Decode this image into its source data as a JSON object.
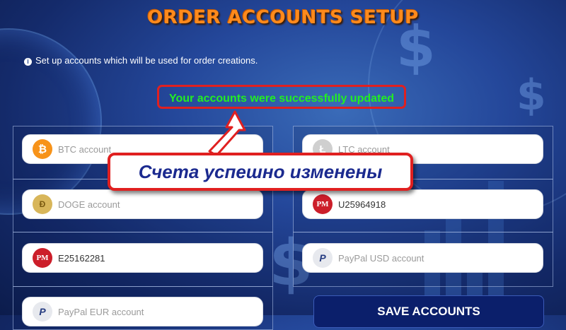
{
  "title": "ORDER ACCOUNTS SETUP",
  "info_text": "Set up accounts which will be used for order creations.",
  "success_message": "Your accounts were successfully updated",
  "callout_text": "Счета успешно изменены",
  "fields": {
    "btc": {
      "icon": "bitcoin-icon",
      "glyph": "₿",
      "placeholder": "BTC account",
      "value": ""
    },
    "ltc": {
      "icon": "litecoin-icon",
      "glyph": "Ł",
      "placeholder": "LTC account",
      "value": ""
    },
    "doge": {
      "icon": "dogecoin-icon",
      "glyph": "Ð",
      "placeholder": "DOGE account",
      "value": ""
    },
    "pm_usd": {
      "icon": "perfect-money-icon",
      "glyph": "PM",
      "placeholder": "",
      "value": "U25964918"
    },
    "pm_eur": {
      "icon": "perfect-money-icon",
      "glyph": "PM",
      "placeholder": "",
      "value": "E25162281"
    },
    "paypal_usd": {
      "icon": "paypal-icon",
      "glyph": "P",
      "placeholder": "PayPal USD account",
      "value": ""
    },
    "paypal_eur": {
      "icon": "paypal-icon",
      "glyph": "P",
      "placeholder": "PayPal EUR account",
      "value": ""
    }
  },
  "save_label": "SAVE ACCOUNTS",
  "colors": {
    "title": "#ff8a1c",
    "success": "#22ee22",
    "highlight": "#e02020",
    "callout_text": "#1b2a8f",
    "save_bg": "#0b1f6b"
  }
}
